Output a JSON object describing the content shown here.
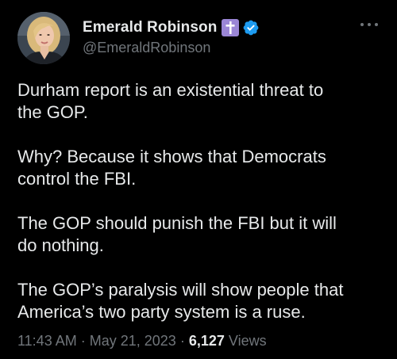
{
  "author": {
    "display_name": "Emerald Robinson",
    "handle": "@EmeraldRobinson",
    "avatar_icon": "profile-photo",
    "badges": [
      "cross-icon",
      "verified-badge-icon"
    ]
  },
  "tweet": {
    "paragraphs": [
      "Durham report is an existential threat to\nthe GOP.",
      "Why? Because it shows that Democrats\ncontrol the FBI.",
      "The GOP should punish the FBI but it will\ndo nothing.",
      "The GOP’s paralysis will show people that\nAmerica’s two party system is a ruse."
    ],
    "time": "11:43 AM",
    "separator": "·",
    "date": "May 21, 2023",
    "views_count": "6,127",
    "views_label": "Views"
  },
  "colors": {
    "background": "#000000",
    "text_primary": "#e7e9ea",
    "text_secondary": "#71767b",
    "verified_blue": "#1d9bf0",
    "cross_badge": "#9b86d6"
  }
}
